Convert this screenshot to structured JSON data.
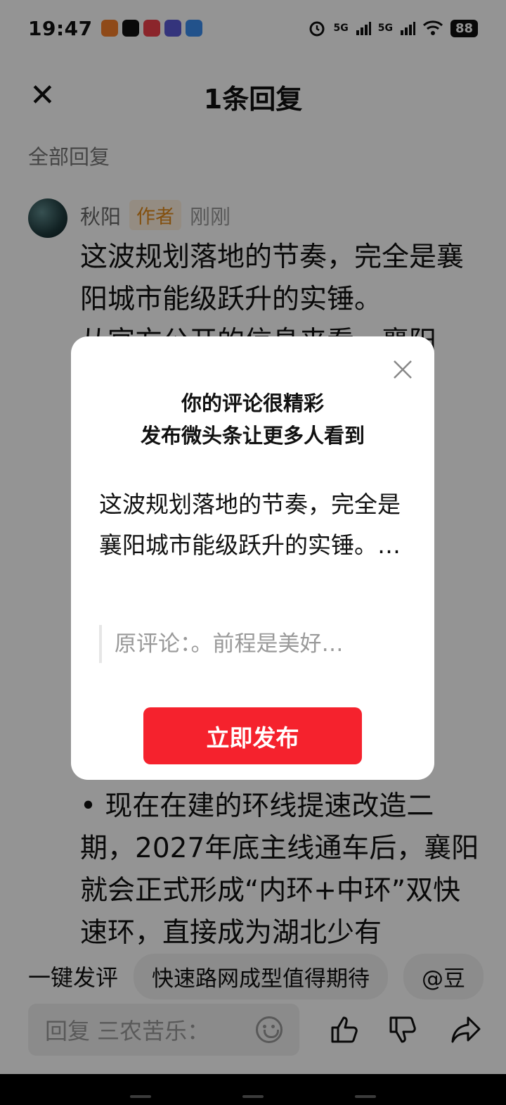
{
  "status_bar": {
    "time": "19:47",
    "signal_1": "5G",
    "signal_2": "5G",
    "battery": "88"
  },
  "header": {
    "title": "1条回复",
    "section_label": "全部回复"
  },
  "comment": {
    "author": "秋阳",
    "author_tag": "作者",
    "time": "刚刚",
    "paragraphs": [
      "这波规划落地的节奏，完全是襄阳城市能级跃升的实锤。",
      "从官方公开的信息来看，襄阳",
      "",
      "• 现在在建的环线提速改造二期，2027年底主线通车后，襄阳就会正式形成“内环+中环”双快速环，直接成为湖北少有"
    ]
  },
  "suggestions": {
    "label": "一键发评",
    "chips": [
      "快速路网成型值得期待",
      "@豆"
    ]
  },
  "reply_bar": {
    "placeholder": "回复 三农苦乐："
  },
  "modal": {
    "heading_line1": "你的评论很精彩",
    "heading_line2": "发布微头条让更多人看到",
    "quote": "这波规划落地的节奏，完全是襄阳城市能级跃升的实锤。…",
    "original": "原评论：。前程是美好…",
    "publish_button": "立即发布"
  },
  "icons": [
    "close-icon",
    "emoji-icon",
    "like-icon",
    "dislike-icon",
    "share-icon",
    "modal-close-icon"
  ]
}
